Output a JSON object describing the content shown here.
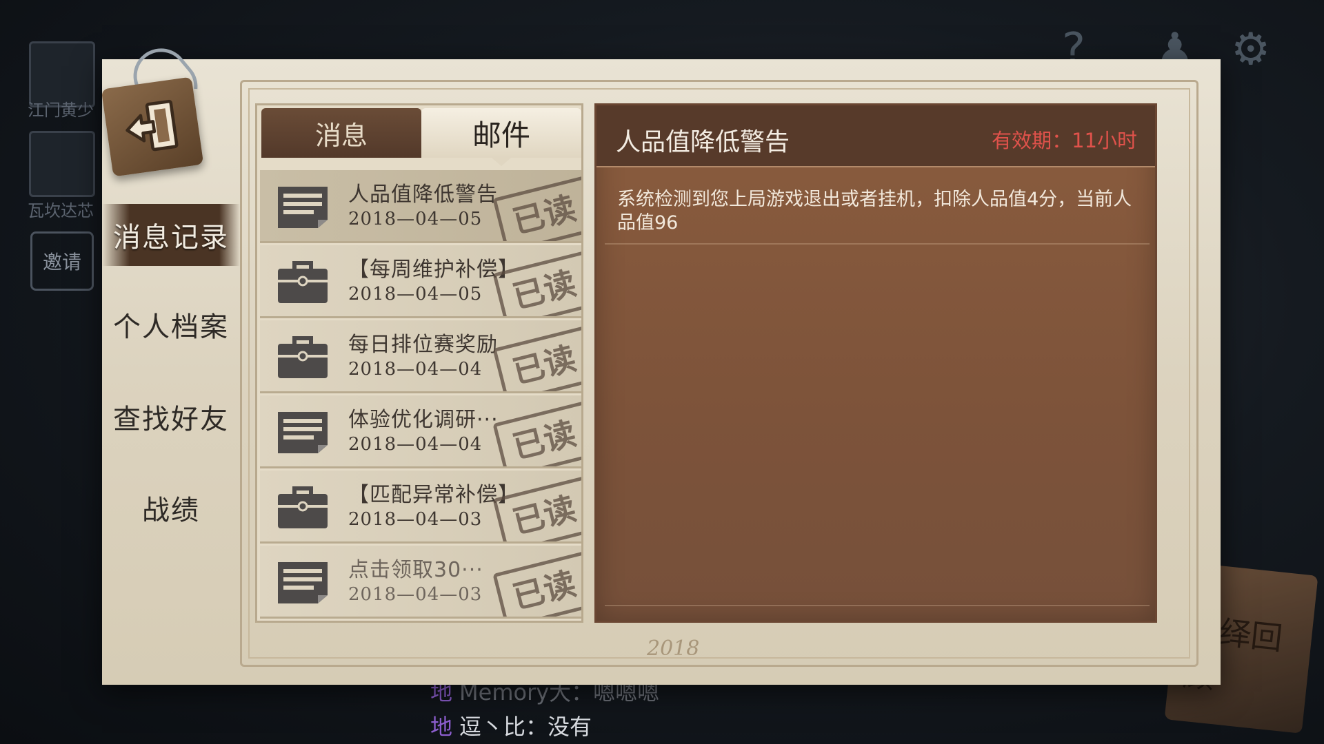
{
  "background": {
    "friends": [
      "江门黄少",
      "瓦坎达芯"
    ],
    "invite_label": "邀请",
    "chat": [
      {
        "tag": "地",
        "text": "Memory大：嗯嗯嗯"
      },
      {
        "tag": "地",
        "text": "逗丶比：没有"
      }
    ],
    "book_text": "演绎回顾",
    "icons": [
      "question-icon",
      "character-icon",
      "gear-icon"
    ]
  },
  "nav": {
    "items": [
      {
        "label": "消息记录",
        "active": true
      },
      {
        "label": "个人档案",
        "active": false
      },
      {
        "label": "查找好友",
        "active": false
      },
      {
        "label": "战绩",
        "active": false
      }
    ]
  },
  "tabs": {
    "messages_label": "消息",
    "mail_label": "邮件",
    "active": "mail"
  },
  "mail_list": [
    {
      "icon": "document-icon",
      "title": "人品值降低警告",
      "date": "2018—04—05",
      "status": "已读",
      "selected": true
    },
    {
      "icon": "briefcase-icon",
      "title": "【每周维护补偿】",
      "date": "2018—04—05",
      "status": "已读",
      "selected": false
    },
    {
      "icon": "briefcase-icon",
      "title": "每日排位赛奖励",
      "date": "2018—04—04",
      "status": "已读",
      "selected": false
    },
    {
      "icon": "document-icon",
      "title": "体验优化调研···",
      "date": "2018—04—04",
      "status": "已读",
      "selected": false
    },
    {
      "icon": "briefcase-icon",
      "title": "【匹配异常补偿】",
      "date": "2018—04—03",
      "status": "已读",
      "selected": false
    },
    {
      "icon": "document-icon",
      "title": "点击领取30···",
      "date": "2018—04—03",
      "status": "已读",
      "selected": false
    }
  ],
  "detail": {
    "title": "人品值降低警告",
    "validity": "有效期：11小时",
    "body": "系统检测到您上局游戏退出或者挂机，扣除人品值4分，当前人品值96"
  },
  "frame_signature": "2018",
  "colors": {
    "paper": "#dcd3bf",
    "detail_bg": "#7d533a",
    "detail_header": "#573a2a",
    "validity_red": "#e0524b",
    "nav_active_bg": "#4a3424"
  }
}
